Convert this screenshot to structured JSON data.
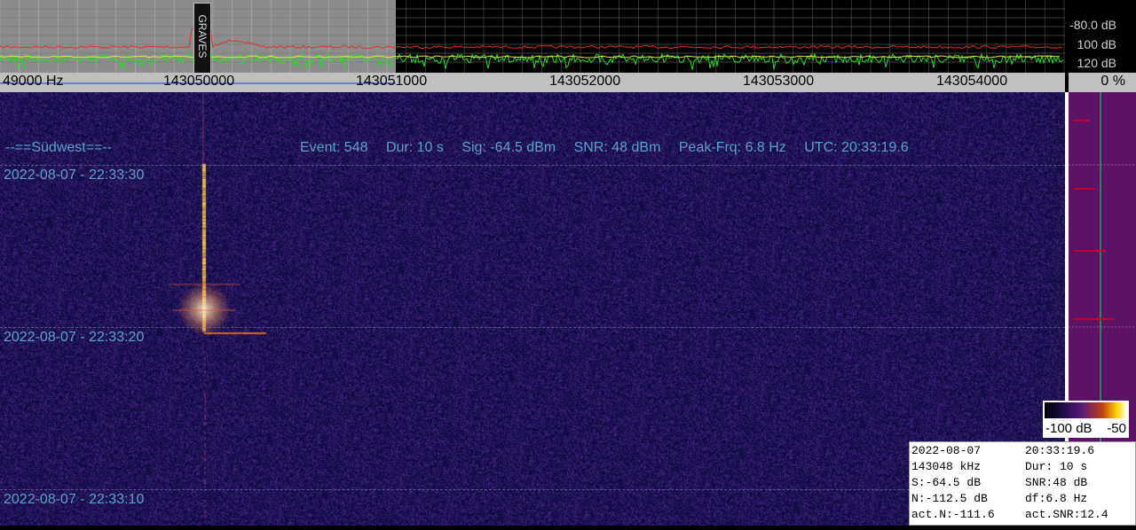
{
  "spectrum": {
    "db_labels": [
      "-80.0 dB",
      "100 dB",
      "120 dB"
    ],
    "marker_text": "GRAVES"
  },
  "frequency_axis": {
    "labels": [
      "49000 Hz",
      "143050000",
      "143051000",
      "143052000",
      "143053000",
      "143054000"
    ],
    "percent": "0 %"
  },
  "waterfall": {
    "station": "--==Südwest==--",
    "event": {
      "event": "Event: 548",
      "dur": "Dur: 10 s",
      "sig": "Sig: -64.5 dBm",
      "snr": "SNR: 48 dBm",
      "peak": "Peak-Frq: 6.8 Hz",
      "utc": "UTC: 20:33:19.6"
    },
    "timestamps": [
      "2022-08-07 - 22:33:30",
      "2022-08-07 - 22:33:20",
      "2022-08-07 - 22:33:10"
    ]
  },
  "colorbar": {
    "min_label": "-100 dB",
    "max_label": "-50"
  },
  "stats": {
    "date": "2022-08-07",
    "time": "20:33:19.6",
    "freq": "143048 kHz",
    "dur": "Dur: 10 s",
    "s": "S:-64.5 dB",
    "snr": "SNR:48 dB",
    "n": "N:-112.5 dB",
    "df": "df:6.8 Hz",
    "act_n": "act.N:-111.6",
    "act_snr": "act.SNR:12.4"
  },
  "colors": {
    "waterfall_bg": "#151858",
    "label_blue": "#5f9fd0",
    "side_panel": "#5c1363"
  }
}
